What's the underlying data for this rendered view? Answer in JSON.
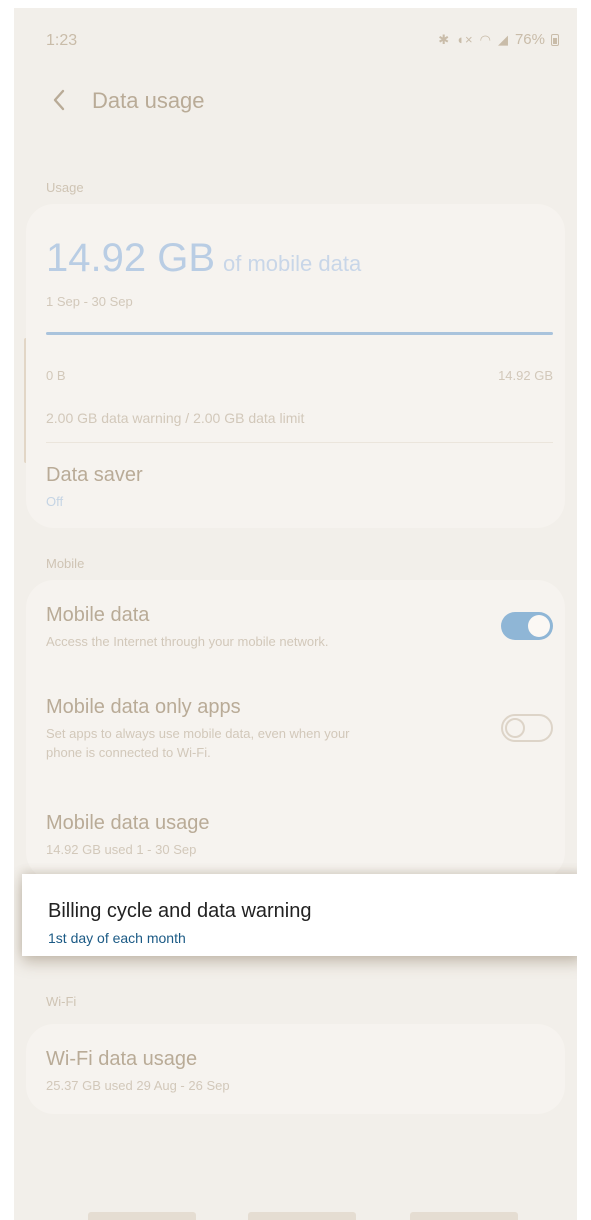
{
  "status_bar": {
    "time": "1:23",
    "icons": [
      "bluetooth-icon",
      "mute-icon",
      "wifi-icon",
      "signal-icon"
    ],
    "battery": "76%"
  },
  "header": {
    "title": "Data usage"
  },
  "usage": {
    "section_label": "Usage",
    "amount": "14.92 GB",
    "amount_unit": "of mobile data",
    "period": "1 Sep - 30 Sep",
    "bar_fill_fraction": 1.0,
    "bar_min": "0 B",
    "bar_max": "14.92 GB",
    "warning_text": "2.00 GB data warning / 2.00 GB data limit",
    "data_saver": {
      "title": "Data saver",
      "value": "Off"
    }
  },
  "mobile": {
    "section_label": "Mobile",
    "items": [
      {
        "title": "Mobile data",
        "subtitle": "Access the Internet through your mobile network.",
        "toggle": true
      },
      {
        "title": "Mobile data only apps",
        "subtitle_line1": "Set apps to always use mobile data, even when your",
        "subtitle_line2": "phone is connected to Wi-Fi.",
        "toggle": false
      },
      {
        "title": "Mobile data usage",
        "subtitle": "14.92 GB used 1 - 30 Sep"
      },
      {
        "title": "Billing cycle and data warning",
        "subtitle": "1st day of each month"
      }
    ]
  },
  "wifi": {
    "section_label": "Wi-Fi",
    "items": [
      {
        "title": "Wi-Fi data usage",
        "subtitle": "25.37 GB used 29 Aug - 26 Sep"
      }
    ]
  },
  "colors": {
    "accent_blue": "#1b5a85",
    "toggle_on": "#8fb6d6",
    "background": "#f2efea"
  }
}
